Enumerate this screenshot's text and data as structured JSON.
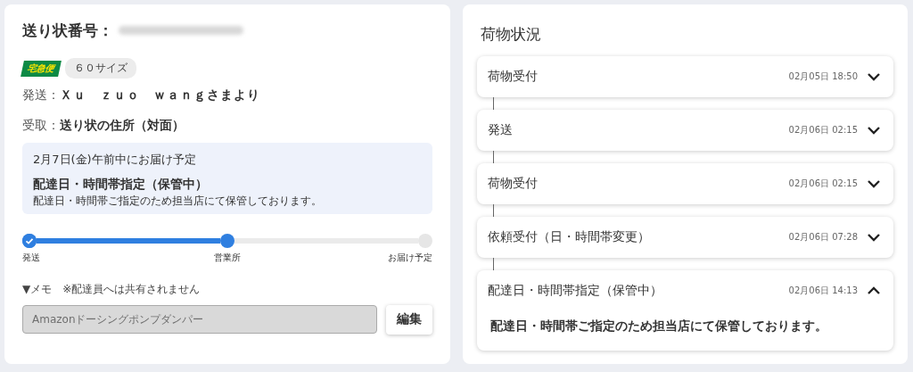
{
  "shipment": {
    "title_label": "送り状番号：",
    "service_badge": "宅急便",
    "size_tag": "６０サイズ",
    "sender": {
      "label": "発送：",
      "value": "Ｘｕ　ｚｕｏ　ｗａｎｇさまより"
    },
    "receiver": {
      "label": "受取：",
      "value": "送り状の住所（対面）"
    },
    "notice": {
      "date": "2月7日(金)午前中にお届け予定",
      "status": "配達日・時間帯指定（保管中）",
      "detail": "配達日・時間帯ご指定のため担当店にて保管しております。"
    },
    "progress": {
      "steps": [
        {
          "label": "発送",
          "done": true,
          "reached": true
        },
        {
          "label": "営業所",
          "done": false,
          "reached": true
        },
        {
          "label": "お届け予定",
          "done": false,
          "reached": false
        }
      ]
    },
    "memo": {
      "label": "▼メモ　※配達員へは共有されません",
      "value": "Amazonドーシングポンプダンパー",
      "disabled": true,
      "button": "編集"
    }
  },
  "tracking": {
    "title": "荷物状況",
    "events": [
      {
        "title": "荷物受付",
        "time": "02月05日 18:50",
        "expanded": false
      },
      {
        "title": "発送",
        "time": "02月06日 02:15",
        "expanded": false
      },
      {
        "title": "荷物受付",
        "time": "02月06日 02:15",
        "expanded": false
      },
      {
        "title": "依頼受付（日・時間帯変更）",
        "time": "02月06日 07:28",
        "expanded": false
      },
      {
        "title": "配達日・時間帯指定（保管中）",
        "time": "02月06日 14:13",
        "expanded": true,
        "detail": "配達日・時間帯ご指定のため担当店にて保管しております。"
      }
    ]
  }
}
